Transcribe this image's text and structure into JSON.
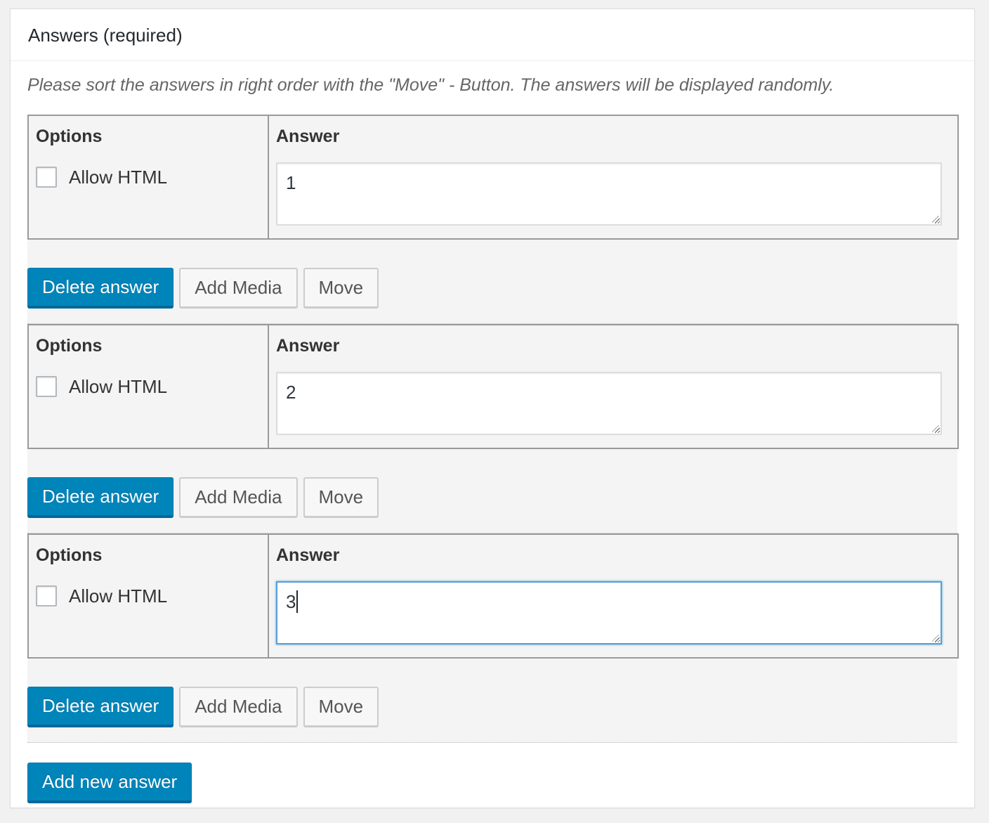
{
  "box": {
    "title": "Answers (required)",
    "description": "Please sort the answers in right order with the \"Move\" - Button. The answers will be displayed randomly."
  },
  "answers": [
    {
      "options_heading": "Options",
      "allow_html_label": "Allow HTML",
      "allow_html_checked": false,
      "answer_heading": "Answer",
      "answer_value": "1",
      "delete_label": "Delete answer",
      "add_media_label": "Add Media",
      "move_label": "Move"
    },
    {
      "options_heading": "Options",
      "allow_html_label": "Allow HTML",
      "allow_html_checked": false,
      "answer_heading": "Answer",
      "answer_value": "2",
      "delete_label": "Delete answer",
      "add_media_label": "Add Media",
      "move_label": "Move"
    },
    {
      "options_heading": "Options",
      "allow_html_label": "Allow HTML",
      "allow_html_checked": false,
      "answer_heading": "Answer",
      "answer_value": "3",
      "delete_label": "Delete answer",
      "add_media_label": "Add Media",
      "move_label": "Move"
    }
  ],
  "add_new_label": "Add new answer",
  "colors": {
    "primary": "#0085ba",
    "primary_border": "#0073aa",
    "focus": "#5b9dd9",
    "panel_bg": "#f4f4f4"
  }
}
